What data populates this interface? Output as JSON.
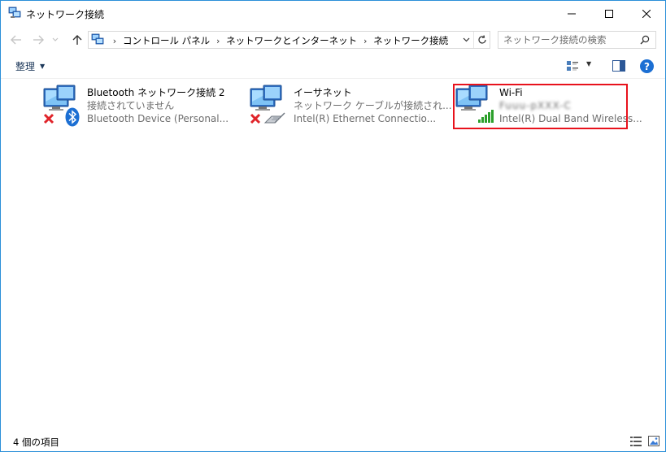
{
  "window": {
    "title": "ネットワーク接続",
    "icon": "network-connections-icon"
  },
  "address_bar": {
    "breadcrumbs": [
      "コントロール パネル",
      "ネットワークとインターネット",
      "ネットワーク接続"
    ]
  },
  "search": {
    "placeholder": "ネットワーク接続の検索"
  },
  "command_bar": {
    "organize_label": "整理"
  },
  "connections": [
    {
      "name": "Bluetooth ネットワーク接続 2",
      "status": "接続されていません",
      "device": "Bluetooth Device (Personal...",
      "badge": "bluetooth-icon",
      "disconnected": true
    },
    {
      "name": "イーサネット",
      "status": "ネットワーク ケーブルが接続され...",
      "device": "Intel(R) Ethernet Connectio...",
      "badge": "ethernet-cable-icon",
      "disconnected": true
    },
    {
      "name": "Wi-Fi",
      "status": "Fuuu-pXXX-C",
      "device": "Intel(R) Dual Band Wireless...",
      "badge": "wifi-signal-icon",
      "disconnected": false
    }
  ],
  "status_bar": {
    "item_count": "4 個の項目"
  },
  "colors": {
    "highlight": "#e8121c",
    "accent": "#1c6fd3",
    "border": "#2b8fd9",
    "secondary_text": "#6d6d6d"
  }
}
